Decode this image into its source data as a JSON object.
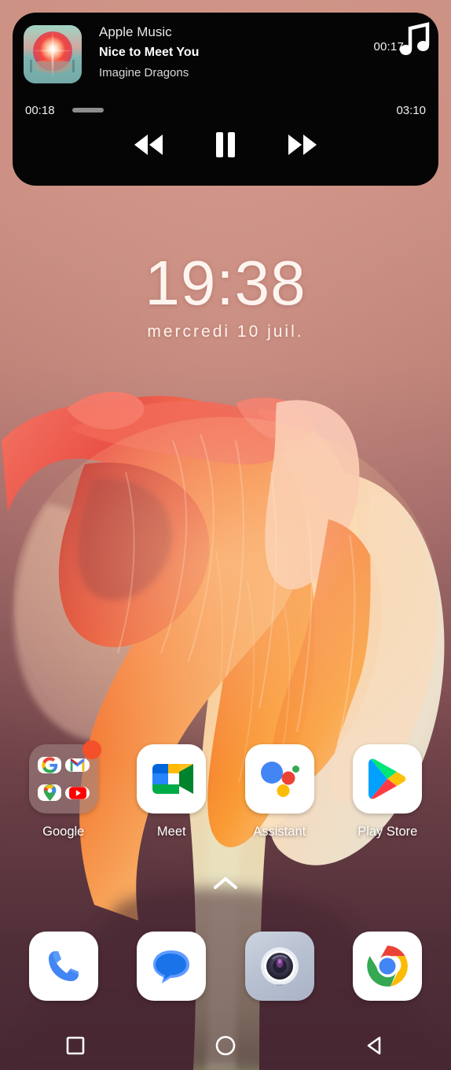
{
  "media_widget": {
    "app_name": "Apple Music",
    "track_title": "Nice to Meet You",
    "artist": "Imagine Dragons",
    "time_remaining": "00:17",
    "time_elapsed": "00:18",
    "time_total": "03:10",
    "progress_percent": 10,
    "album_art_name": "album-art-sunset",
    "music_note_icon": "music-note-icon",
    "controls": [
      {
        "name": "rewind-button",
        "label": "Rewind"
      },
      {
        "name": "pause-button",
        "label": "Pause"
      },
      {
        "name": "fast-forward-button",
        "label": "Fast forward"
      }
    ],
    "background_color": "#050505"
  },
  "clock": {
    "time": "19:38",
    "date": "mercredi 10 juil.",
    "text_color": "#fdf4ef"
  },
  "app_grid": [
    {
      "label": "Google",
      "icon": "google-folder-icon",
      "type": "folder",
      "has_badge": true,
      "badge_color": "#f4502a",
      "folder_items": [
        "google-g-icon",
        "gmail-icon",
        "google-maps-icon",
        "youtube-icon"
      ]
    },
    {
      "label": "Meet",
      "icon": "google-meet-icon",
      "type": "app",
      "has_badge": false
    },
    {
      "label": "Assistant",
      "icon": "google-assistant-icon",
      "type": "app",
      "has_badge": false
    },
    {
      "label": "Play Store",
      "icon": "google-play-store-icon",
      "type": "app",
      "has_badge": false
    }
  ],
  "drawer_handle": {
    "icon": "chevron-up-icon"
  },
  "dock": [
    {
      "label": "Phone",
      "icon": "phone-icon"
    },
    {
      "label": "Messages",
      "icon": "messages-icon"
    },
    {
      "label": "Camera",
      "icon": "camera-icon"
    },
    {
      "label": "Chrome",
      "icon": "chrome-icon"
    }
  ],
  "nav_bar": [
    {
      "label": "Recents",
      "icon": "square-recents-icon"
    },
    {
      "label": "Home",
      "icon": "circle-home-icon"
    },
    {
      "label": "Back",
      "icon": "triangle-back-icon"
    }
  ],
  "wallpaper": {
    "description": "Abstract orange flower petals",
    "top_color": "#cb9083",
    "bottom_color": "#472833"
  }
}
